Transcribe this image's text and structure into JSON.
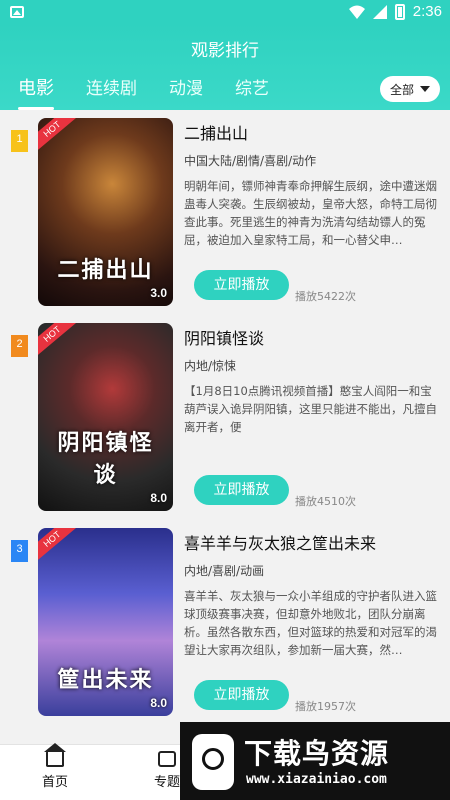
{
  "statusbar": {
    "time": "2:36"
  },
  "header": {
    "title": "观影排行",
    "tabs": [
      {
        "label": "电影",
        "active": true
      },
      {
        "label": "连续剧",
        "active": false
      },
      {
        "label": "动漫",
        "active": false
      },
      {
        "label": "综艺",
        "active": false
      }
    ],
    "filter_label": "全部"
  },
  "items": [
    {
      "rank": "1",
      "badge": "HOT",
      "poster_title": "二捕出山",
      "score": "3.0",
      "name": "二捕出山",
      "genre": "中国大陆/剧情/喜剧/动作",
      "desc": "明朝年间，镖师神青奉命押解生辰纲，途中遭迷烟蛊毒人突袭。生辰纲被劫，皇帝大怒，命特工局彻查此事。死里逃生的神青为洗清勾结劫镖人的冤屈，被迫加入皇家特工局，和一心替父申…",
      "play_label": "立即播放",
      "plays": "播放5422次"
    },
    {
      "rank": "2",
      "badge": "HOT",
      "poster_title": "阴阳镇怪谈",
      "score": "8.0",
      "name": "阴阳镇怪谈",
      "genre": "内地/惊悚",
      "desc": "【1月8日10点腾讯视频首播】憨宝人阎阳一和宝葫芦误入诡异阴阳镇，这里只能进不能出，凡擅自离开者，便",
      "play_label": "立即播放",
      "plays": "播放4510次"
    },
    {
      "rank": "3",
      "badge": "HOT",
      "poster_title": "筐出未来",
      "score": "8.0",
      "name": "喜羊羊与灰太狼之筐出未来",
      "genre": "内地/喜剧/动画",
      "desc": "喜羊羊、灰太狼与一众小羊组成的守护者队进入篮球顶级赛事决赛，但却意外地败北，团队分崩离析。虽然各散东西，但对篮球的热爱和对冠军的渴望让大家再次组队，参加新一届大赛，然…",
      "play_label": "立即播放",
      "plays": "播放1957次"
    }
  ],
  "bottom_nav": [
    {
      "label": "首页",
      "icon": "home-icon"
    },
    {
      "label": "专题",
      "icon": "topic-icon"
    }
  ],
  "watermark": {
    "text": "下载鸟资源",
    "url": "www.xiazainiao.com"
  }
}
